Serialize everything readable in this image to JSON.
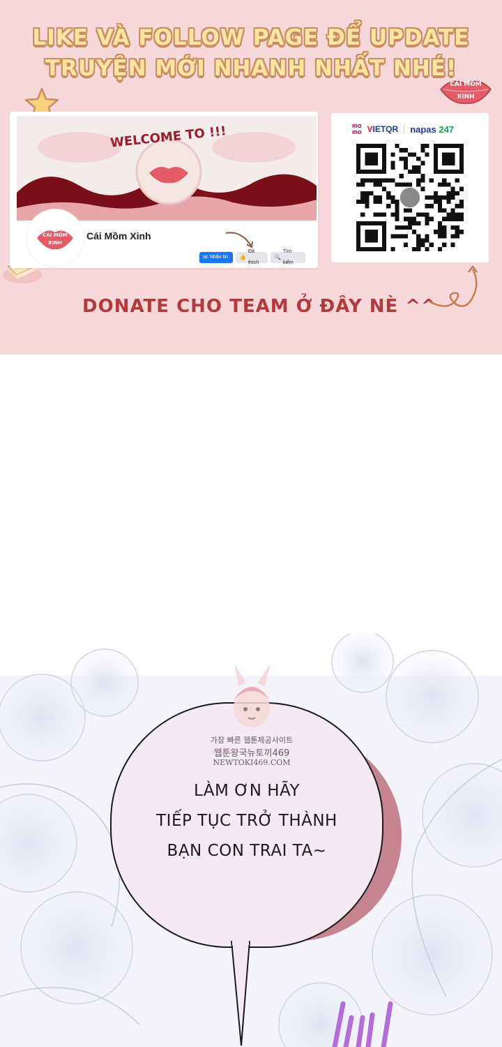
{
  "banner": {
    "headline_line1": "LIKE VÀ FOLLOW PAGE ĐỂ UPDATE",
    "headline_line2": "TRUYỆN MỚI NHANH NHẤT NHÉ!",
    "sticker_text_1": "CÁI MỒM",
    "sticker_text_2": "XINH",
    "facebook_card": {
      "cover_title": "WELCOME TO !!!",
      "avatar_text_1": "CÁI MỒM",
      "avatar_text_2": "XINH",
      "page_name": "Cái Mồm Xinh",
      "buttons": {
        "message": "Nhắn tin",
        "liked": "Đã thích",
        "search": "Tìm kiếm"
      }
    },
    "qr_card": {
      "momo_1": "mo",
      "momo_2": "mo",
      "vietqr_v": "V",
      "vietqr_rest": "IETQR",
      "napas": "napas",
      "napas_247": "247"
    },
    "donate_text": "DONATE CHO TEAM Ở ĐÂY NÈ ^^",
    "colors": {
      "banner_bg": "#f6d8da",
      "headline_fill": "#fbe3a2",
      "headline_outline": "#c98d63",
      "donate": "#b33a3a"
    }
  },
  "panel": {
    "bubble_text": [
      "LÀM ƠN HÃY",
      "TIẾP TỤC TRỞ THÀNH",
      "BẠN CON TRAI TA~"
    ],
    "watermark": {
      "line1": "가장 빠른 웹툰제공사이트",
      "line2": "웹툰왕국뉴토끼469",
      "line3": "NEWTOKI469.COM"
    }
  }
}
